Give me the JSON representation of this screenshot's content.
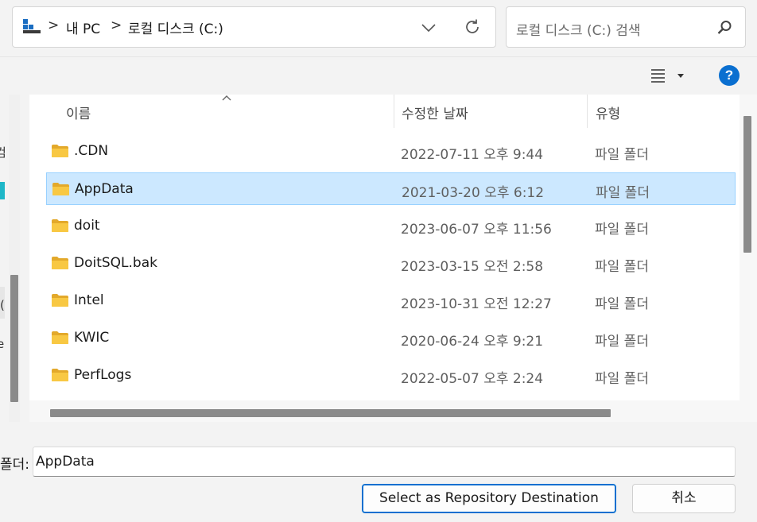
{
  "address_bar": {
    "breadcrumbs": [
      "내 PC",
      "로컬 디스크 (C:)"
    ],
    "separator": ">",
    "pc_icon": "pc-icon",
    "dropdown_icon": "chevron-down-icon",
    "refresh_icon": "refresh-icon"
  },
  "search": {
    "placeholder": "로컬 디스크 (C:) 검색",
    "icon": "search-icon"
  },
  "toolbar": {
    "view_icon": "view-options-icon",
    "help_label": "?"
  },
  "nav_pane": {
    "fragments": [
      "컴",
      "(",
      "e"
    ]
  },
  "columns": {
    "name": "이름",
    "date_modified": "수정한 날짜",
    "type": "유형"
  },
  "files": [
    {
      "name": ".CDN",
      "date": "2022-07-11 오후 9:44",
      "type": "파일 폴더",
      "selected": false
    },
    {
      "name": "AppData",
      "date": "2021-03-20 오후 6:12",
      "type": "파일 폴더",
      "selected": true
    },
    {
      "name": "doit",
      "date": "2023-06-07 오후 11:56",
      "type": "파일 폴더",
      "selected": false
    },
    {
      "name": "DoitSQL.bak",
      "date": "2023-03-15 오전 2:58",
      "type": "파일 폴더",
      "selected": false
    },
    {
      "name": "Intel",
      "date": "2023-10-31 오전 12:27",
      "type": "파일 폴더",
      "selected": false
    },
    {
      "name": "KWIC",
      "date": "2020-06-24 오후 9:21",
      "type": "파일 폴더",
      "selected": false
    },
    {
      "name": "PerfLogs",
      "date": "2022-05-07 오후 2:24",
      "type": "파일 폴더",
      "selected": false
    }
  ],
  "footer": {
    "folder_label": "폴더:",
    "folder_value": "AppData",
    "select_button": "Select as Repository Destination",
    "cancel_button": "취소"
  },
  "colors": {
    "selection_bg": "#cce8ff",
    "selection_border": "#99d1ff",
    "accent": "#0a6fd0",
    "folder_yellow": "#f8c843"
  }
}
